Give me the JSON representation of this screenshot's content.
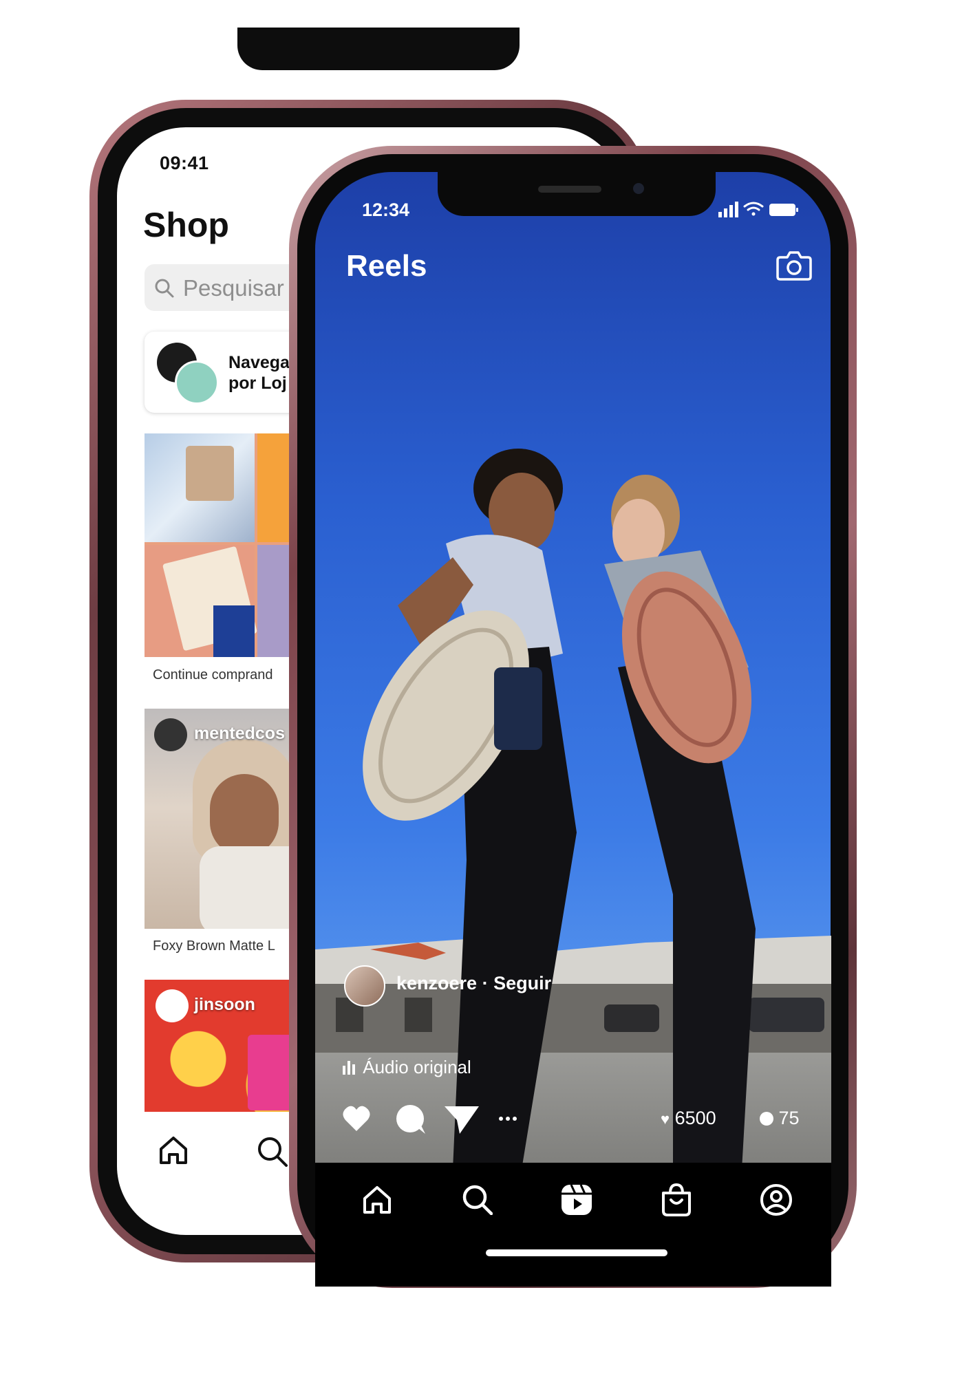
{
  "shop_screen": {
    "status_time": "09:41",
    "title": "Shop",
    "search_placeholder": "Pesquisar",
    "shop_card": {
      "line1": "Navega",
      "line2": "por Loj"
    },
    "collage_caption": "Continue comprand",
    "post1": {
      "username": "mentedcos",
      "caption": "Foxy Brown Matte L"
    },
    "post2": {
      "username": "jinsoon"
    },
    "nav": [
      "home-icon",
      "search-icon"
    ]
  },
  "reels_screen": {
    "status_time": "12:34",
    "status_icons": [
      "signal-icon",
      "wifi-icon",
      "battery-icon"
    ],
    "title": "Reels",
    "username": "kenzoere",
    "follow_label": "Seguir",
    "separator": "·",
    "audio_label": "Áudio original",
    "likes": "6500",
    "comments": "75",
    "actions": [
      "heart-icon",
      "comment-icon",
      "share-icon",
      "more-icon"
    ],
    "tabs": [
      "home-icon",
      "search-icon",
      "reels-icon",
      "shop-icon",
      "profile-icon"
    ]
  },
  "colors": {
    "phone_frame": "#7c434a",
    "sky": "#2a5fd0",
    "tabbar": "#000000"
  }
}
